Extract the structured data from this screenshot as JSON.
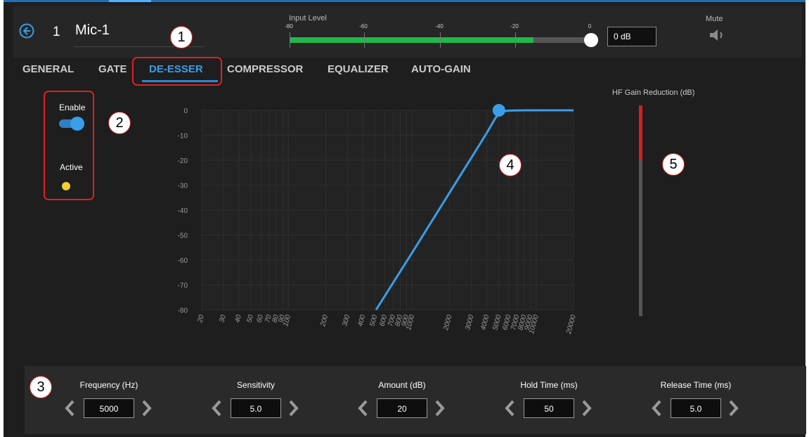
{
  "channel": {
    "number": "1",
    "name": "Mic-1"
  },
  "input_level": {
    "title": "Input Level",
    "ticks": [
      "-80",
      "-60",
      "-40",
      "-20",
      "0"
    ],
    "level_db": -15,
    "gain_value": "0 dB"
  },
  "mute": {
    "title": "Mute"
  },
  "tabs": [
    {
      "label": "GENERAL"
    },
    {
      "label": "GATE"
    },
    {
      "label": "DE-ESSER",
      "active": true
    },
    {
      "label": "COMPRESSOR"
    },
    {
      "label": "EQUALIZER"
    },
    {
      "label": "AUTO-GAIN"
    }
  ],
  "enable": {
    "label": "Enable",
    "on": true
  },
  "active": {
    "label": "Active",
    "color": "#f0d030"
  },
  "callouts": [
    "1",
    "2",
    "3",
    "4",
    "5"
  ],
  "chart_data": {
    "type": "line",
    "x_scale": "log",
    "xlim": [
      20,
      20000
    ],
    "ylim": [
      -80,
      0
    ],
    "y_ticks": [
      "0",
      "-10",
      "-20",
      "-30",
      "-40",
      "-50",
      "-60",
      "-70",
      "-80"
    ],
    "x_ticks": [
      "20",
      "30",
      "40",
      "50",
      "60",
      "70",
      "80",
      "90",
      "100",
      "200",
      "300",
      "400",
      "500",
      "600",
      "700",
      "800",
      "900",
      "1000",
      "2000",
      "3000",
      "4000",
      "5000",
      "6000",
      "7000",
      "8000",
      "9000",
      "10000",
      "20000"
    ],
    "series": [
      {
        "x": [
          510,
          1000,
          2000,
          3000,
          4000,
          4700,
          5200,
          6000,
          8000,
          12000,
          20000
        ],
        "y": [
          -80,
          -57,
          -33,
          -19,
          -9,
          -3,
          -0.6,
          -0.1,
          0,
          0,
          0
        ]
      }
    ],
    "marker": {
      "x": 5000,
      "y": 0
    },
    "line_color": "#3a9ee8"
  },
  "hf_gain_reduction": {
    "title": "HF Gain Reduction (dB)",
    "fill_fraction": 0.26
  },
  "params": [
    {
      "label": "Frequency (Hz)",
      "value": "5000"
    },
    {
      "label": "Sensitivity",
      "value": "5.0"
    },
    {
      "label": "Amount (dB)",
      "value": "20"
    },
    {
      "label": "Hold Time (ms)",
      "value": "50"
    },
    {
      "label": "Release Time (ms)",
      "value": "5.0"
    }
  ]
}
